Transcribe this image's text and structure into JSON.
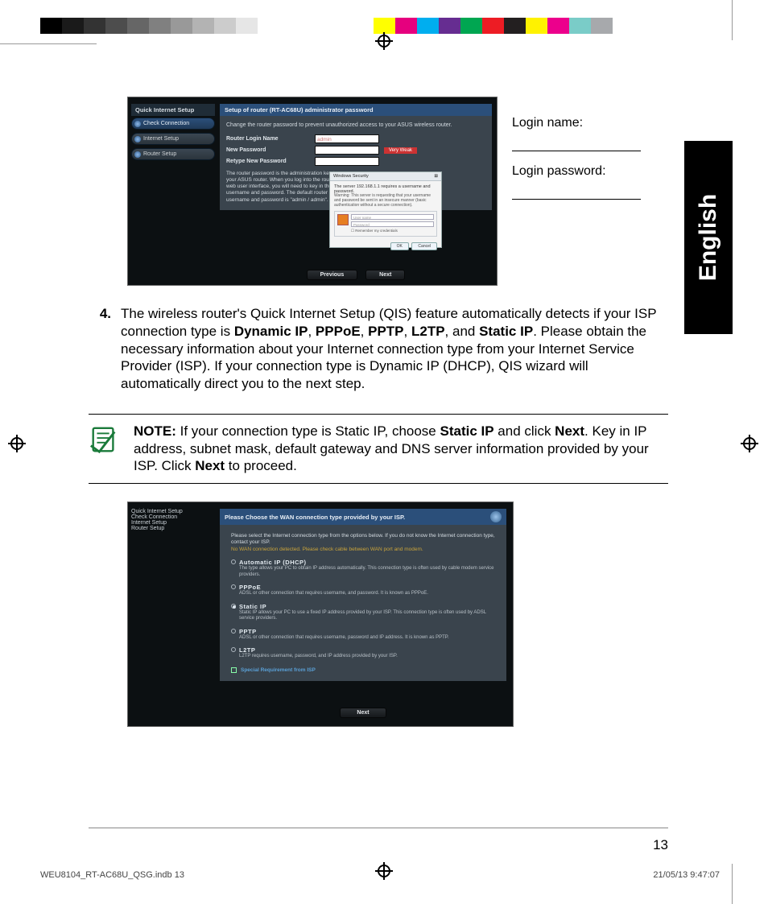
{
  "color_bar_gray": [
    "#000000",
    "#1a1a1a",
    "#333333",
    "#4d4d4d",
    "#666666",
    "#808080",
    "#999999",
    "#b3b3b3",
    "#cccccc",
    "#e6e6e6",
    "#ffffff"
  ],
  "color_bar_right": [
    "#ffffff",
    "#ffff00",
    "#e6007e",
    "#00aeef",
    "#662d91",
    "#00a651",
    "#ed1c24",
    "#231f20",
    "#fff200",
    "#ec008c",
    "#7accc8",
    "#a7a9ac"
  ],
  "language_tab": "English",
  "fig1": {
    "sidebar_title": "Quick Internet Setup",
    "side1": "Check Connection",
    "side2": "Internet Setup",
    "side3": "Router Setup",
    "title": "Setup of router (RT-AC68U) administrator password",
    "intro": "Change the router password to prevent unauthorized access to your ASUS wireless router.",
    "lbl_login": "Router Login Name",
    "val_login": "admin",
    "lbl_new": "New Password",
    "strength": "Very Weak",
    "lbl_retype": "Retype New Password",
    "para": "The router password is the administration key to your ASUS router. When you log into the router's web user interface, you will need to key in the username and password. The default router username and password is \"admin / admin\".",
    "popup_title": "Windows Security",
    "popup_sub": "The server 192.168.1.1  requires a username and password.",
    "popup_warn": "Warning: This server is requesting that your username and password be sent in an insecure manner (basic authentication without a secure connection).",
    "popup_user": "User name",
    "popup_pass": "Password",
    "popup_remember": "Remember my credentials",
    "popup_ok": "OK",
    "popup_cancel": "Cancel",
    "prev": "Previous",
    "next": "Next"
  },
  "login_name_label": "Login name:",
  "login_password_label": "Login password:",
  "step4_num": "4.",
  "step4_pre": "The wireless router's Quick Internet Setup (QIS) feature automatically detects if your ISP connection type is ",
  "step4_b1": "Dynamic IP",
  "step4_s1": ", ",
  "step4_b2": "PPPoE",
  "step4_s2": ", ",
  "step4_b3": "PPTP",
  "step4_s3": ", ",
  "step4_b4": "L2TP",
  "step4_s4": ", and ",
  "step4_b5": "Static IP",
  "step4_post": ". Please obtain the necessary information about your Internet connection type from your Internet Service Provider (ISP). If your connection type is Dynamic IP (DHCP), QIS wizard will automatically direct you to the next step.",
  "note_label": "NOTE:",
  "note_1": "   If your connection type is Static IP, choose ",
  "note_b1": "Static IP",
  "note_2": " and click ",
  "note_b2": "Next",
  "note_3": ". Key in IP address, subnet mask, default gateway and DNS server information provided by your ISP. Click ",
  "note_b3": "Next",
  "note_4": " to proceed.",
  "fig2": {
    "sidebar_title": "Quick Internet Setup",
    "side1": "Check Connection",
    "side2": "Internet Setup",
    "side3": "Router Setup",
    "title": "Please Choose the WAN connection type provided by your ISP.",
    "intro1": "Please select the Internet connection type from the options below. If you do not know the Internet connection type, contact your ISP.",
    "intro_warn": "No WAN connection detected. Please check cable between WAN port and modem.",
    "opt1_name": "Automatic IP (DHCP)",
    "opt1_desc": "The type allows your PC to obtain IP address automatically. This connection type is often used by cable modem service providers.",
    "opt2_name": "PPPoE",
    "opt2_desc": "ADSL or other connection that requires username, and password. It is known as PPPoE.",
    "opt3_name": "Static IP",
    "opt3_desc": "Static IP allows your PC to use a fixed IP address provided by your ISP. This connection type is often used by ADSL service providers.",
    "opt4_name": "PPTP",
    "opt4_desc": "ADSL or other connection that requires username, password and IP address. It is known as PPTP.",
    "opt5_name": "L2TP",
    "opt5_desc": "L2TP requires username, password, and IP address provided by your ISP.",
    "special": "Special Requirement from ISP",
    "next": "Next"
  },
  "page_number": "13",
  "slug_file": "WEU8104_RT-AC68U_QSG.indb   13",
  "slug_date": "21/05/13   9:47:07"
}
